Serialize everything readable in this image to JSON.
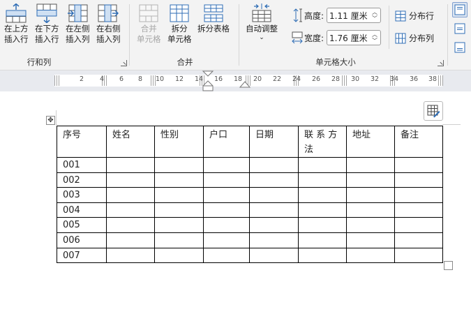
{
  "ribbon": {
    "rows_cols": {
      "insert_above_1": "在上方",
      "insert_above_2": "插入行",
      "insert_below_1": "在下方",
      "insert_below_2": "插入行",
      "insert_left_1": "在左侧",
      "insert_left_2": "插入列",
      "insert_right_1": "在右侧",
      "insert_right_2": "插入列",
      "group_label": "行和列"
    },
    "merge": {
      "merge_cells_1": "合并",
      "merge_cells_2": "单元格",
      "split_cells_1": "拆分",
      "split_cells_2": "单元格",
      "split_table": "拆分表格",
      "group_label": "合并"
    },
    "cell_size": {
      "autofit": "自动调整",
      "height_label": "高度:",
      "height_value": "1.11 厘米",
      "width_label": "宽度:",
      "width_value": "1.76 厘米",
      "distribute_rows": "分布行",
      "distribute_cols": "分布列",
      "group_label": "单元格大小"
    }
  },
  "ruler": {
    "ticks": [
      "2",
      "4",
      "6",
      "8",
      "10",
      "12",
      "14",
      "16",
      "18",
      "20",
      "22",
      "24",
      "26",
      "28",
      "30",
      "32",
      "34",
      "36",
      "38"
    ]
  },
  "table": {
    "header": [
      "序号",
      "姓名",
      "性别",
      "户口",
      "日期",
      "联 系 方\n法",
      "地址",
      "备注"
    ],
    "rows": [
      [
        "001",
        "",
        "",
        "",
        "",
        "",
        "",
        ""
      ],
      [
        "002",
        "",
        "",
        "",
        "",
        "",
        "",
        ""
      ],
      [
        "003",
        "",
        "",
        "",
        "",
        "",
        "",
        ""
      ],
      [
        "004",
        "",
        "",
        "",
        "",
        "",
        "",
        ""
      ],
      [
        "005",
        "",
        "",
        "",
        "",
        "",
        "",
        ""
      ],
      [
        "006",
        "",
        "",
        "",
        "",
        "",
        "",
        ""
      ],
      [
        "007",
        "",
        "",
        "",
        "",
        "",
        "",
        ""
      ]
    ]
  },
  "colors": {
    "icon_blue": "#2f6db5",
    "icon_light_blue": "#cfe0f3",
    "ribbon_bg": "#f3f3f3",
    "ruler_bg": "#e8eaef"
  }
}
